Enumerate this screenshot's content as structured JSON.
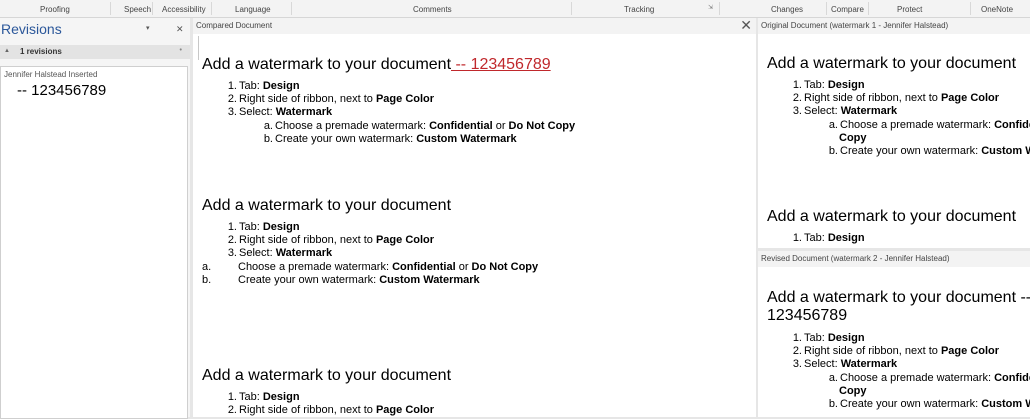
{
  "ribbon": {
    "groups": [
      "Proofing",
      "Speech",
      "Accessibility",
      "Language",
      "Comments",
      "Tracking",
      "Changes",
      "Compare",
      "Protect",
      "OneNote"
    ]
  },
  "revisions_pane": {
    "title": "Revisions",
    "count_label": "1 revisions",
    "author_line": "Jennifer Halstead Inserted",
    "inserted_text": "-- 123456789"
  },
  "compared": {
    "header": "Compared Document",
    "heading": "Add a watermark to your document",
    "inserted": " -- 123456789",
    "section2_heading": "Add a watermark to your document",
    "section3_heading": "Add a watermark to your document"
  },
  "steps": {
    "n1": "1.",
    "n2": "2.",
    "n3": "3.",
    "na": "a.",
    "nb": "b.",
    "tab_prefix": "Tab: ",
    "tab_value": "Design",
    "ribbon_prefix": "Right side of ribbon, next to ",
    "ribbon_value": "Page Color",
    "select_prefix": "Select: ",
    "select_value": "Watermark",
    "premade_prefix": "Choose a premade watermark: ",
    "premade_v1": "Confidential",
    "premade_or": " or ",
    "premade_v2": "Do Not Copy",
    "own_prefix": "Create your own watermark: ",
    "own_value": "Custom Watermark",
    "premade_v1_trunc": "Confide",
    "copy_wrap": "Copy",
    "own_value_trunc": "Custom W"
  },
  "original": {
    "header": "Original Document (watermark 1 - Jennifer Halstead)",
    "heading": "Add a watermark to your document",
    "heading2": "Add a watermark to your document"
  },
  "revised": {
    "header": "Revised Document (watermark 2 - Jennifer Halstead)",
    "heading_line1": "Add a watermark to your document --",
    "heading_line2": "123456789"
  },
  "colors": {
    "accent": "#2b579a",
    "insertion": "#c0282c"
  }
}
